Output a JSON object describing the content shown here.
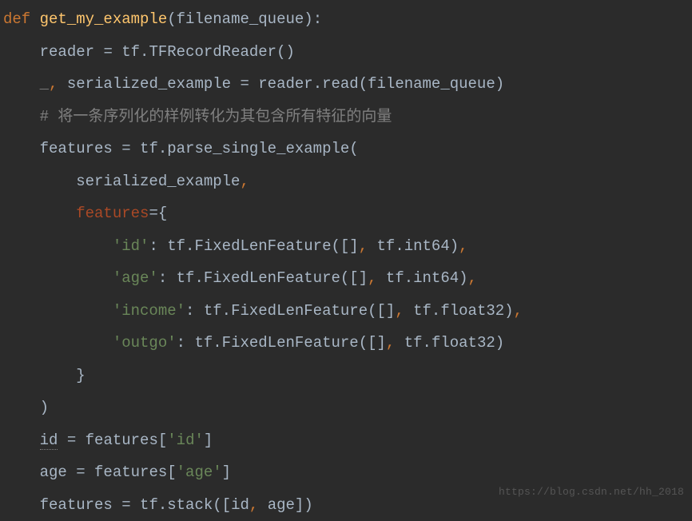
{
  "code": {
    "l1": {
      "def": "def ",
      "fn": "get_my_example",
      "open": "(",
      "p1": "filename_queue",
      "close": "):"
    },
    "l2": {
      "indent": "    ",
      "lhs": "reader ",
      "eq": "= ",
      "rhs1": "tf.TFRecordReader",
      "paren": "()"
    },
    "l3": {
      "indent": "    ",
      "u": "_",
      "comma": ",",
      "sp": " ",
      "lhs": "serialized_example ",
      "eq": "= ",
      "r1": "reader.read",
      "open": "(",
      "arg": "filename_queue",
      "close": ")"
    },
    "l4": {
      "indent": "    ",
      "hash": "# ",
      "text": "将一条序列化的样例转化为其包含所有特征的向量"
    },
    "l5": {
      "indent": "    ",
      "lhs": "features ",
      "eq": "= ",
      "r1": "tf.parse_single_example",
      "open": "("
    },
    "l6": {
      "indent": "        ",
      "arg": "serialized_example",
      "comma": ","
    },
    "l7": {
      "indent": "        ",
      "kw": "features",
      "eq": "=",
      "brace": "{"
    },
    "l8": {
      "indent": "            ",
      "key": "'id'",
      "colon": ": ",
      "r1": "tf.FixedLenFeature",
      "open": "(",
      "b": "[]",
      "comma1": ",",
      "sp": " ",
      "t": "tf.int64",
      "close": ")",
      "tcomma": ","
    },
    "l9": {
      "indent": "            ",
      "key": "'age'",
      "colon": ": ",
      "r1": "tf.FixedLenFeature",
      "open": "(",
      "b": "[]",
      "comma1": ",",
      "sp": " ",
      "t": "tf.int64",
      "close": ")",
      "tcomma": ","
    },
    "l10": {
      "indent": "            ",
      "key": "'income'",
      "colon": ": ",
      "r1": "tf.FixedLenFeature",
      "open": "(",
      "b": "[]",
      "comma1": ",",
      "sp": " ",
      "t": "tf.float32",
      "close": ")",
      "tcomma": ","
    },
    "l11": {
      "indent": "            ",
      "key": "'outgo'",
      "colon": ": ",
      "r1": "tf.FixedLenFeature",
      "open": "(",
      "b": "[]",
      "comma1": ",",
      "sp": " ",
      "t": "tf.float32",
      "close": ")"
    },
    "l12": {
      "indent": "        ",
      "brace": "}"
    },
    "l13": {
      "indent": "    ",
      "close": ")"
    },
    "l14": {
      "indent": "    ",
      "lhs": "id",
      "sp": " ",
      "eq": "= ",
      "r1": "features",
      "open": "[",
      "key": "'id'",
      "close": "]"
    },
    "l15": {
      "indent": "    ",
      "lhs": "age ",
      "eq": "= ",
      "r1": "features",
      "open": "[",
      "key": "'age'",
      "close": "]"
    },
    "l16": {
      "indent": "    ",
      "lhs": "features ",
      "eq": "= ",
      "r1": "tf.stack",
      "open": "(",
      "b": "[",
      "a1": "id",
      "comma": ",",
      "sp": " ",
      "a2": "age",
      "cb": "]",
      "close": ")"
    }
  },
  "watermark": "https://blog.csdn.net/hh_2018"
}
